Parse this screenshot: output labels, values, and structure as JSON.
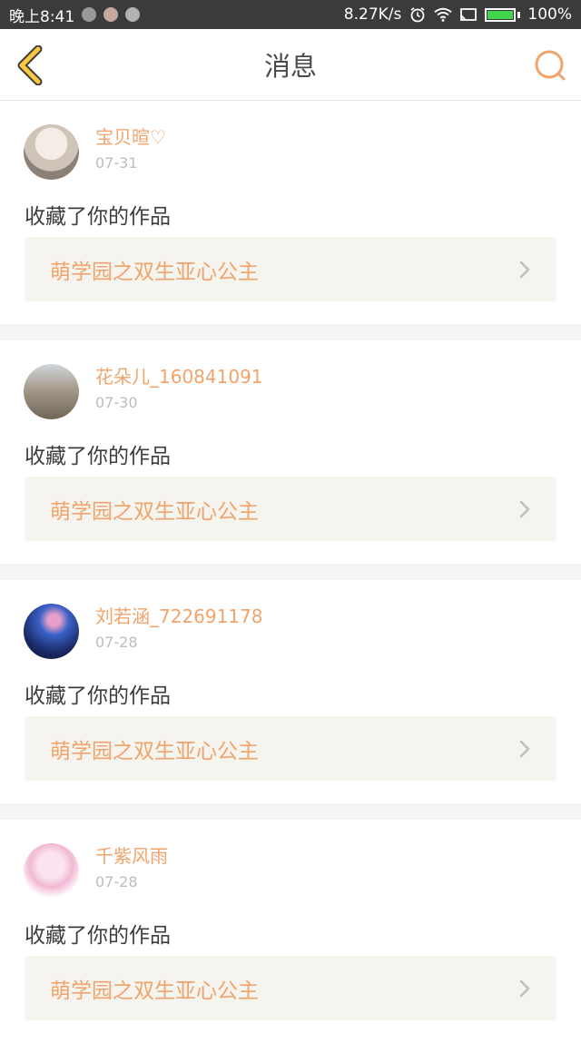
{
  "status_bar": {
    "time": "晚上8:41",
    "network_speed": "8.27K/s",
    "battery": "100%",
    "icons": [
      "notification-icon",
      "notification-icon",
      "notification-icon",
      "alarm-icon",
      "wifi-icon",
      "screen-cast-icon",
      "battery-icon"
    ]
  },
  "header": {
    "title": "消息",
    "back_icon": "back-chevron-icon",
    "search_icon": "search-icon"
  },
  "colors": {
    "accent": "#f0a46c",
    "back_icon": "#f5c842",
    "card_bg": "#ffffff",
    "work_bg": "#f5f4ef",
    "page_bg": "#f7f5f3"
  },
  "messages": [
    {
      "username": "宝贝暄♡",
      "date": "07-31",
      "action": "收藏了你的作品",
      "work_title": "萌学园之双生亚心公主"
    },
    {
      "username": "花朵儿_160841091",
      "date": "07-30",
      "action": "收藏了你的作品",
      "work_title": "萌学园之双生亚心公主"
    },
    {
      "username": "刘若涵_722691178",
      "date": "07-28",
      "action": "收藏了你的作品",
      "work_title": "萌学园之双生亚心公主"
    },
    {
      "username": "千紫风雨",
      "date": "07-28",
      "action": "收藏了你的作品",
      "work_title": "萌学园之双生亚心公主"
    }
  ]
}
